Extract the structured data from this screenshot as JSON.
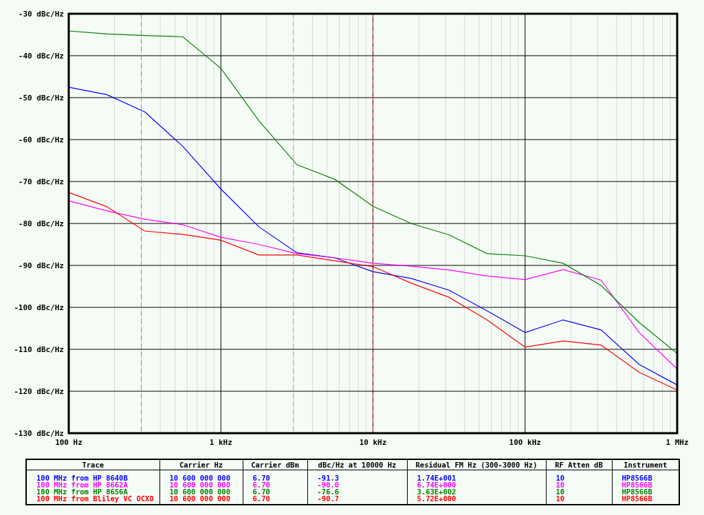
{
  "plot": {
    "chart_data": {
      "type": "line",
      "categories": [
        "100 Hz",
        null,
        null,
        null,
        "1 kHz",
        null,
        null,
        null,
        "10 kHz",
        null,
        null,
        null,
        "100 kHz",
        null,
        null,
        null,
        "1 MHz"
      ],
      "ylim": [
        -130,
        -30
      ],
      "yticks": [
        {
          "value": -30,
          "label": "-30 dBc/Hz"
        },
        {
          "value": -40,
          "label": "-40 dBc/Hz"
        },
        {
          "value": -50,
          "label": "-50 dBc/Hz"
        },
        {
          "value": -60,
          "label": "-60 dBc/Hz"
        },
        {
          "value": -70,
          "label": "-70 dBc/Hz"
        },
        {
          "value": -80,
          "label": "-80 dBc/Hz"
        },
        {
          "value": -90,
          "label": "-90 dBc/Hz"
        },
        {
          "value": -100,
          "label": "-100 dBc/Hz"
        },
        {
          "value": -110,
          "label": "-110 dBc/Hz"
        },
        {
          "value": -120,
          "label": "-120 dBc/Hz"
        },
        {
          "value": -130,
          "label": "-130 dBc/Hz"
        }
      ],
      "series": [
        {
          "color": "#0000ff",
          "values": [
            -47.5,
            -49.3,
            -53.4,
            -61.6,
            -71.8,
            -80.8,
            -87,
            -88.2,
            -91.5,
            -93.1,
            -95.9,
            -100.8,
            -106,
            -103,
            -105.4,
            -113.6,
            -118.5
          ]
        },
        {
          "color": "#ff00ff",
          "values": [
            -74.6,
            -77,
            -79,
            -80.3,
            -83.3,
            -85,
            -87.2,
            -88.2,
            -89.5,
            -90.2,
            -91.1,
            -92.5,
            -93.4,
            -91,
            -93.5,
            -106,
            -114.7
          ]
        },
        {
          "color": "#008000",
          "values": [
            -34.1,
            -34.8,
            -35.2,
            -35.5,
            -43,
            -55.5,
            -66,
            -69.5,
            -75.9,
            -80,
            -82.7,
            -87.2,
            -87.7,
            -89.5,
            -94.8,
            -103.6,
            -111
          ]
        },
        {
          "color": "#ff0000",
          "values": [
            -72.6,
            -76,
            -81.8,
            -82.6,
            -84,
            -87.5,
            -87.5,
            -88.9,
            -90.3,
            -94.2,
            -97.6,
            -103,
            -109.5,
            -108,
            -109,
            -115.5,
            -119.7
          ]
        }
      ],
      "grid": true,
      "ref_lines": [
        {
          "axis": "x",
          "value": "10 kHz",
          "color": "#ff0000"
        }
      ]
    }
  },
  "table": {
    "columns": [
      "Trace",
      "Carrier Hz",
      "Carrier dBm",
      "dBc/Hz at 10000 Hz",
      "Residual FM Hz (300-3000 Hz)",
      "RF Atten dB",
      "Instrument"
    ],
    "rows": [
      {
        "color": "#0000ff",
        "cells": [
          "100 MHz from HP 8640B",
          "10 600 000 000",
          "6.70",
          "-91.3",
          "1.74E+001",
          "10",
          "HP8566B"
        ]
      },
      {
        "color": "#ff00ff",
        "cells": [
          "100 MHz from HP 8662A",
          "10 600 000 000",
          "6.70",
          "-90.0",
          "6.74E+000",
          "10",
          "HP8566B"
        ]
      },
      {
        "color": "#008000",
        "cells": [
          "100 MHz from HP 8656A",
          "10 600 000 000",
          "6.70",
          "-76.6",
          "3.63E+002",
          "10",
          "HP8566B"
        ]
      },
      {
        "color": "#ff0000",
        "cells": [
          "100 MHz from Bliley VC OCXO",
          "10 600 000 000",
          "6.70",
          "-90.7",
          "5.72E+000",
          "10",
          "HP8566B"
        ]
      }
    ]
  }
}
